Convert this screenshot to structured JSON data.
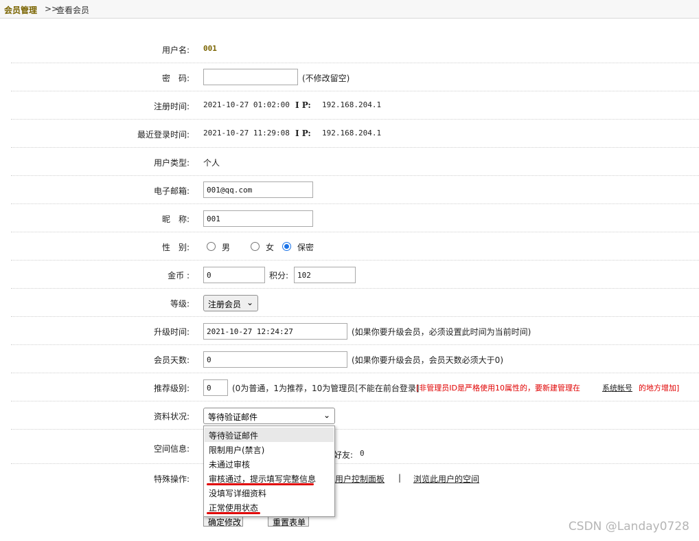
{
  "breadcrumb": {
    "section": "会员管理",
    "separator": ">>",
    "page": "查看会员"
  },
  "form": {
    "username": {
      "label": "用户名:",
      "value": "001"
    },
    "password": {
      "label": "密　码:",
      "value": "",
      "hint": "(不修改留空)"
    },
    "reg_time": {
      "label": "注册时间:",
      "value": "2021-10-27 01:02:00",
      "ip_label": "I P:",
      "ip": "192.168.204.1"
    },
    "last_login": {
      "label": "最近登录时间:",
      "value": "2021-10-27 11:29:08",
      "ip_label": "I P:",
      "ip": "192.168.204.1"
    },
    "user_type": {
      "label": "用户类型:",
      "value": "个人"
    },
    "email": {
      "label": "电子邮箱:",
      "value": "001@qq.com"
    },
    "nickname": {
      "label": "昵　称:",
      "value": "001"
    },
    "gender": {
      "label": "性　别:",
      "options": [
        "男",
        "女",
        "保密"
      ],
      "selected": "保密"
    },
    "coins": {
      "label": "金币 :",
      "value": "0",
      "points_label": "积分:",
      "points": "102"
    },
    "level": {
      "label": "等级:",
      "value": "注册会员"
    },
    "upgrade_time": {
      "label": "升级时间:",
      "value": "2021-10-27 12:24:27",
      "hint": "(如果你要升级会员，必须设置此时间为当前时间)"
    },
    "member_days": {
      "label": "会员天数:",
      "value": "0",
      "hint": "(如果你要升级会员，会员天数必须大于0)"
    },
    "recommend": {
      "label": "推荐级别:",
      "value": "0",
      "hint": "(0为普通，1为推荐，10为管理员[不能在前台登录]",
      "warn_prefix": "[非管理员ID是严格使用10属性的，要新建管理在",
      "warn_link": "系统帐号",
      "warn_suffix": "的地方增加]"
    },
    "status": {
      "label": "资料状况:",
      "value": "等待验证邮件",
      "options": [
        "等待验证邮件",
        "限制用户(禁言)",
        "未通过审核",
        "审核通过，提示填写完整信息",
        "没填写详细资料",
        "正常使用状态"
      ]
    },
    "space": {
      "label": "空间信息:",
      "friends_label": "好友:",
      "friends": "0"
    },
    "special": {
      "label": "特殊操作:",
      "link1_tail": "用户控制面板",
      "separator": "|",
      "link2": "浏览此用户的空间"
    },
    "buttons": {
      "submit": "确定修改",
      "reset": "重置表单"
    }
  },
  "watermark": "CSDN @Landay0728",
  "colors": {
    "accent_red": "#e00000",
    "breadcrumb_brand": "#7a6400",
    "highlight": "#e8e8e8",
    "radio_selected": "#1a73e8"
  }
}
